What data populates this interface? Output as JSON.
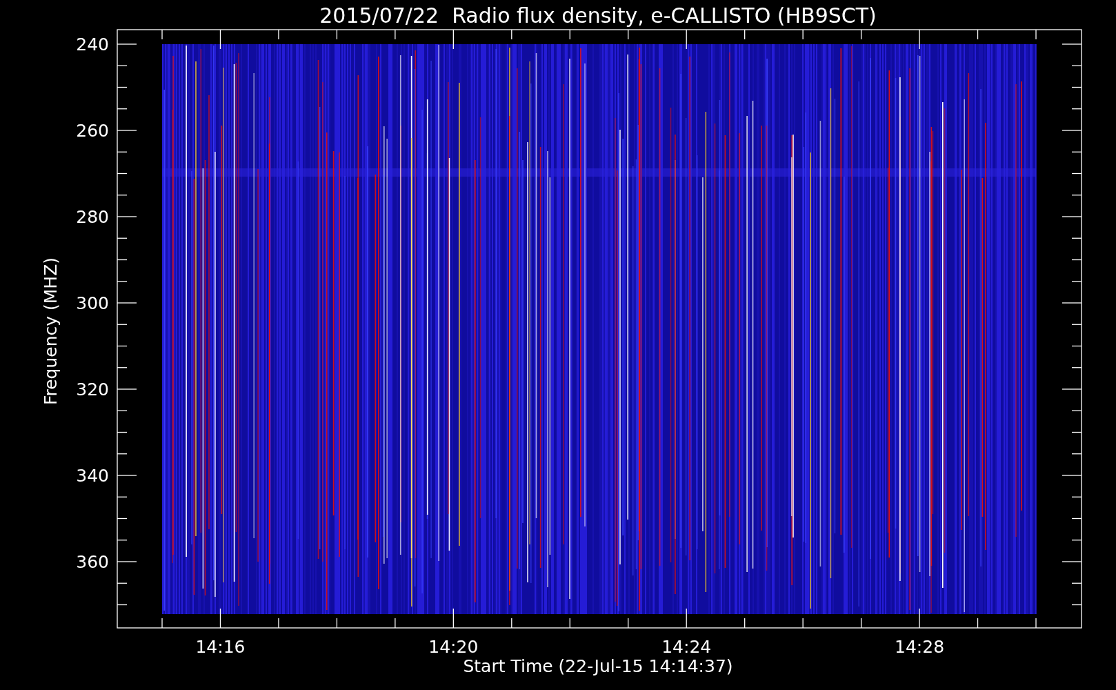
{
  "title": "2015/07/22  Radio flux density, e-CALLISTO (HB9SCT)",
  "y_axis": {
    "label": "Frequency (MHZ)",
    "ticks": [
      "240",
      "260",
      "280",
      "300",
      "320",
      "340",
      "360"
    ]
  },
  "x_axis": {
    "label": "Start Time (22-Jul-15 14:14:37)",
    "ticks": [
      "14:16",
      "14:20",
      "14:24",
      "14:28"
    ]
  }
}
